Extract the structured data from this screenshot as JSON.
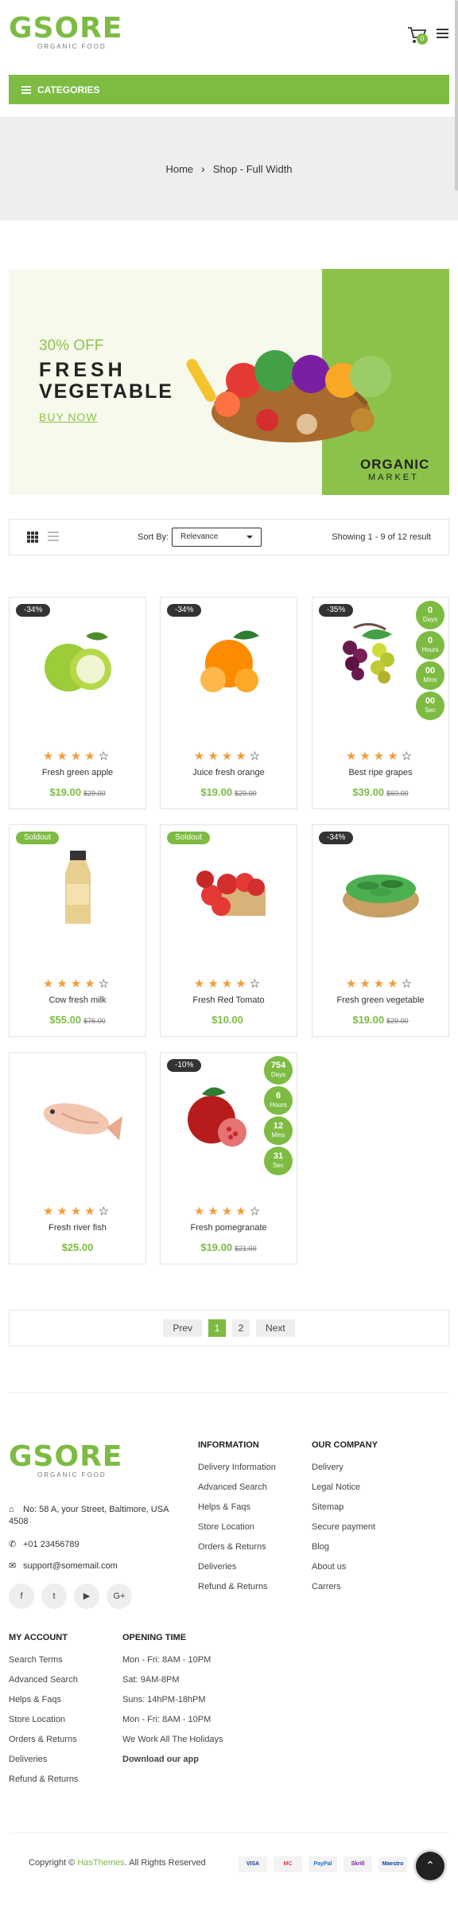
{
  "header": {
    "logo_word": "GSORE",
    "logo_tagline": "ORGANIC FOOD",
    "cart_count": "0"
  },
  "categories_label": "CATEGORIES",
  "breadcrumb": {
    "home": "Home",
    "sep": "›",
    "current": "Shop - Full Width"
  },
  "banner": {
    "discount": "30% OFF",
    "title_line1": "FRESH",
    "title_line2": "VEGETABLE",
    "cta": "BUY NOW",
    "brand_line1": "ORGANIC",
    "brand_line2": "MARKET"
  },
  "toolbar": {
    "sort_label": "Sort By:",
    "sort_value": "Relevance",
    "showing": "Showing 1 - 9 of 12 result"
  },
  "products": [
    {
      "name": "Fresh green apple",
      "price": "$19.00",
      "old": "$29.00",
      "badge": "-34%",
      "rating": 4
    },
    {
      "name": "Juice fresh orange",
      "price": "$19.00",
      "old": "$29.00",
      "badge": "-34%",
      "rating": 4
    },
    {
      "name": "Best ripe grapes",
      "price": "$39.00",
      "old": "$60.00",
      "badge": "-35%",
      "rating": 4,
      "countdown": {
        "days": "0",
        "hours": "0",
        "mins": "00",
        "secs": "00"
      }
    },
    {
      "name": "Cow fresh milk",
      "price": "$55.00",
      "old": "$76.00",
      "badge": "Soldout",
      "rating": 4
    },
    {
      "name": "Fresh Red Tomato",
      "price": "$10.00",
      "old": "",
      "badge": "Soldout",
      "rating": 4
    },
    {
      "name": "Fresh green vegetable",
      "price": "$19.00",
      "old": "$29.00",
      "badge": "-34%",
      "rating": 4
    },
    {
      "name": "Fresh river fish",
      "price": "$25.00",
      "old": "",
      "badge": "",
      "rating": 4
    },
    {
      "name": "Fresh pomegranate",
      "price": "$19.00",
      "old": "$21.00",
      "badge": "-10%",
      "rating": 4,
      "countdown": {
        "days": "754",
        "hours": "6",
        "mins": "12",
        "secs": "31"
      }
    }
  ],
  "countdown_labels": {
    "days": "Days",
    "hours": "Hours",
    "mins": "Mins",
    "secs": "Sec"
  },
  "pagination": {
    "prev": "Prev",
    "page1": "1",
    "page2": "2",
    "next": "Next"
  },
  "footer": {
    "address": "No: 58 A, your Street, Baltimore, USA 4508",
    "phone": "+01 23456789",
    "email": "support@somemail.com",
    "socials": [
      "f",
      "t",
      "▶",
      "G+"
    ],
    "information": {
      "heading": "INFORMATION",
      "items": [
        "Delivery Information",
        "Advanced Search",
        "Helps & Faqs",
        "Store Location",
        "Orders & Returns",
        "Deliveries",
        "Refund & Returns"
      ]
    },
    "company": {
      "heading": "OUR COMPANY",
      "items": [
        "Delivery",
        "Legal Notice",
        "Sitemap",
        "Secure payment",
        "Blog",
        "About us",
        "Carrers"
      ]
    },
    "account": {
      "heading": "MY ACCOUNT",
      "items": [
        "Search Terms",
        "Advanced Search",
        "Helps & Faqs",
        "Store Location",
        "Orders & Returns",
        "Deliveries",
        "Refund & Returns"
      ]
    },
    "hours": {
      "heading": "OPENING TIME",
      "items": [
        "Mon - Fri: 8AM - 10PM",
        "Sat: 9AM-8PM",
        "Suns: 14hPM-18hPM",
        "Mon - Fri: 8AM - 10PM",
        "We Work All The Holidays",
        "Download our app"
      ]
    },
    "copyright_prefix": "Copyright ©",
    "copyright_brand": "HasThemes",
    "copyright_suffix": ". All Rights Reserved",
    "payments": [
      "VISA",
      "MC",
      "PayPal",
      "Skrill",
      "Maestro"
    ]
  },
  "colors": {
    "accent": "#7dbb43",
    "dark": "#333333"
  }
}
